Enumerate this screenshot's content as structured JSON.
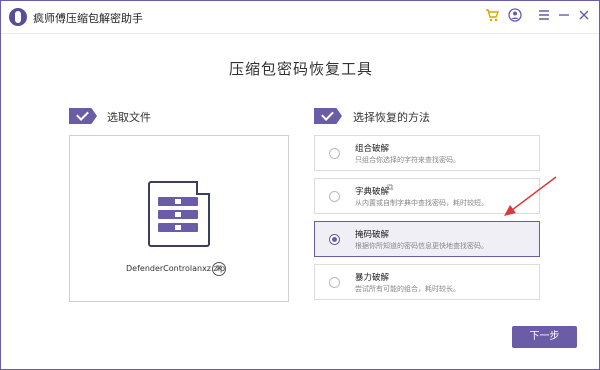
{
  "titlebar": {
    "app_title": "疯师傅压缩包解密助手",
    "icons": [
      "cart-icon",
      "user-icon",
      "menu-icon",
      "minimize-icon",
      "close-icon"
    ]
  },
  "main_title": "压缩包密码恢复工具",
  "steps": {
    "select_file": "选取文件",
    "select_method": "选择恢复的方法"
  },
  "file": {
    "name": "DefenderControlanxz.zip"
  },
  "methods": [
    {
      "title": "组合破解",
      "desc": "只组合你选择的字符来查找密码。",
      "selected": false
    },
    {
      "title": "字典破解",
      "desc": "从内置或自制字典中查找密码，耗时较短。",
      "selected": false
    },
    {
      "title": "掩码破解",
      "desc": "根据你所知道的密码信息更快地查找密码。",
      "selected": true
    },
    {
      "title": "暴力破解",
      "desc": "尝试所有可能的组合，耗时较长。",
      "selected": false
    }
  ],
  "next_label": "下一步",
  "colors": {
    "accent": "#6a5ca6",
    "arrow": "#d93a3a",
    "cart": "#d9a700"
  }
}
